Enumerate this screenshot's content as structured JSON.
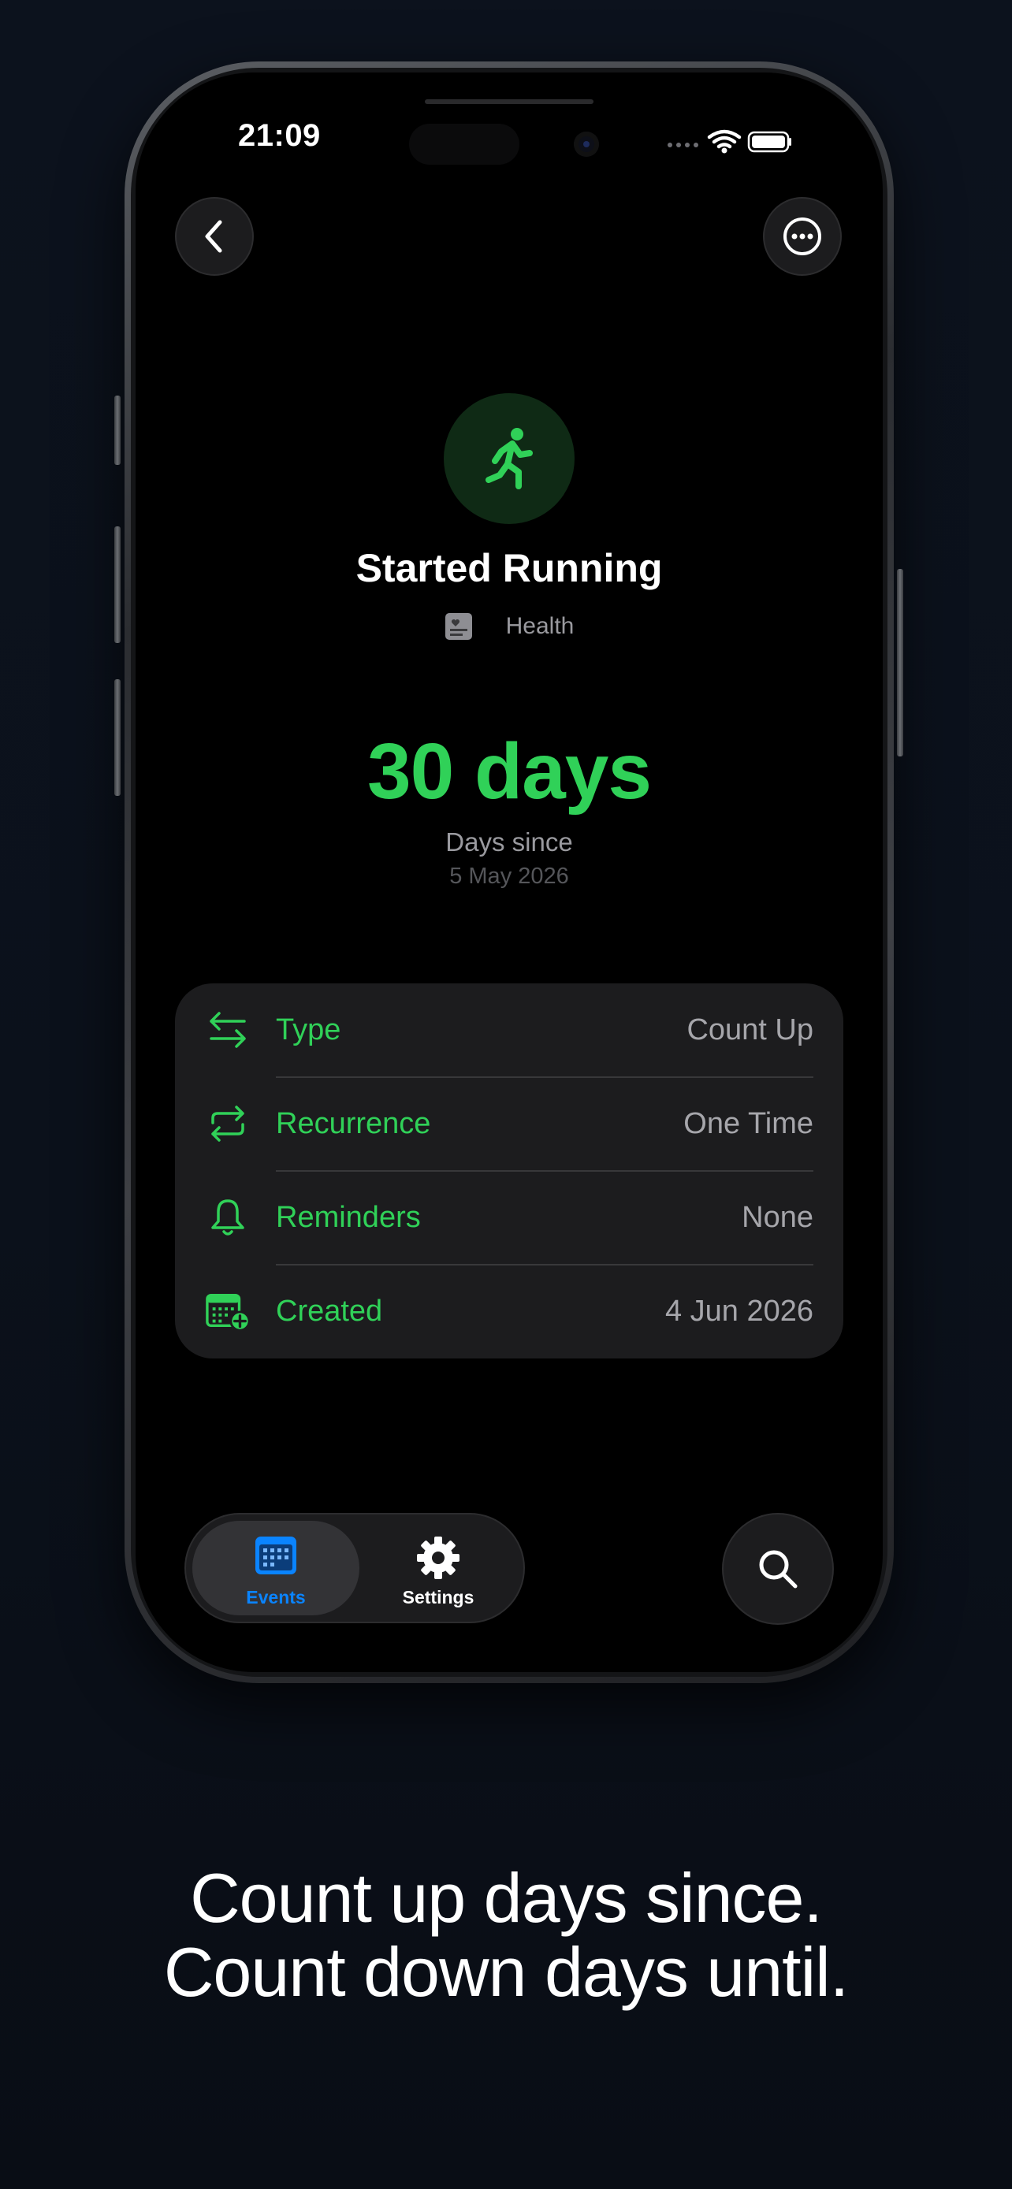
{
  "status_bar": {
    "time": "21:09"
  },
  "nav": {
    "back_icon": "chevron-left-icon",
    "more_icon": "ellipsis-circle-icon"
  },
  "event": {
    "icon": "running-figure-icon",
    "title": "Started Running",
    "category_icon": "health-card-icon",
    "category": "Health",
    "count_value": "30 days",
    "count_label": "Days since",
    "start_date": "5 May 2026"
  },
  "details": [
    {
      "icon": "arrows-left-right-icon",
      "label": "Type",
      "value": "Count Up"
    },
    {
      "icon": "repeat-icon",
      "label": "Recurrence",
      "value": "One Time"
    },
    {
      "icon": "bell-icon",
      "label": "Reminders",
      "value": "None"
    },
    {
      "icon": "calendar-plus-icon",
      "label": "Created",
      "value": "4 Jun 2026"
    }
  ],
  "tabs": [
    {
      "icon": "calendar-icon",
      "label": "Events",
      "active": true
    },
    {
      "icon": "gear-icon",
      "label": "Settings",
      "active": false
    }
  ],
  "search_icon": "search-icon",
  "tagline": {
    "line1": "Count up days since.",
    "line2": "Count down days until."
  },
  "colors": {
    "accent_green": "#30d158",
    "accent_blue": "#0a84ff",
    "card_bg": "#1c1c1e",
    "screen_bg": "#000000",
    "page_bg": "#0b111b",
    "secondary_text": "#a6a6ab"
  }
}
